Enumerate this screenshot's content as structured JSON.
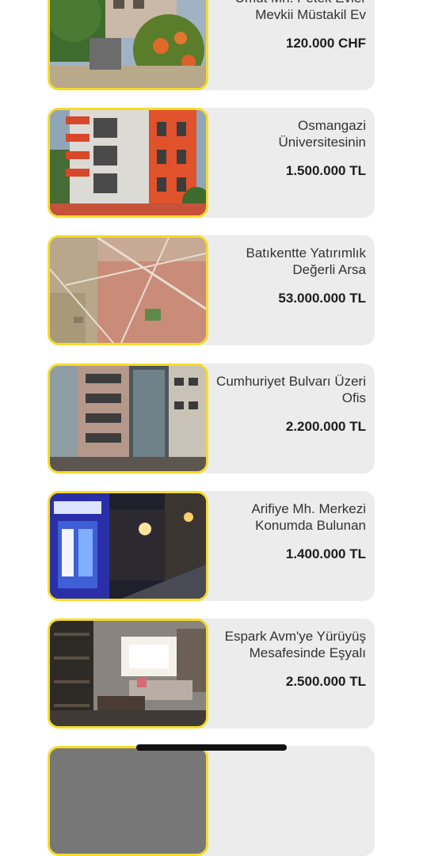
{
  "listings": [
    {
      "title": "Ümüt Mh. Petek Evler Mevkii Müstakil Ev",
      "price": "120.000 CHF",
      "image": "detached-house-with-garden"
    },
    {
      "title": "Osmangazi Üniversitesinin",
      "price": "1.500.000 TL",
      "image": "red-balcony-apartment"
    },
    {
      "title": "Batıkentte Yatırımlık Değerli Arsa",
      "price": "53.000.000 TL",
      "image": "aerial-city-map"
    },
    {
      "title": "Cumhuriyet Bulvarı Üzeri Ofis",
      "price": "2.200.000 TL",
      "image": "office-building-facade"
    },
    {
      "title": "Arifiye Mh. Merkezi Konumda Bulunan",
      "price": "1.400.000 TL",
      "image": "night-street-shopfront"
    },
    {
      "title": "Espark Avm'ye Yürüyüş Mesafesinde Eşyalı",
      "price": "2.500.000 TL",
      "image": "furnished-living-room"
    }
  ],
  "colors": {
    "accent": "#f5dc2a",
    "card": "#ececec",
    "text": "#333333"
  }
}
